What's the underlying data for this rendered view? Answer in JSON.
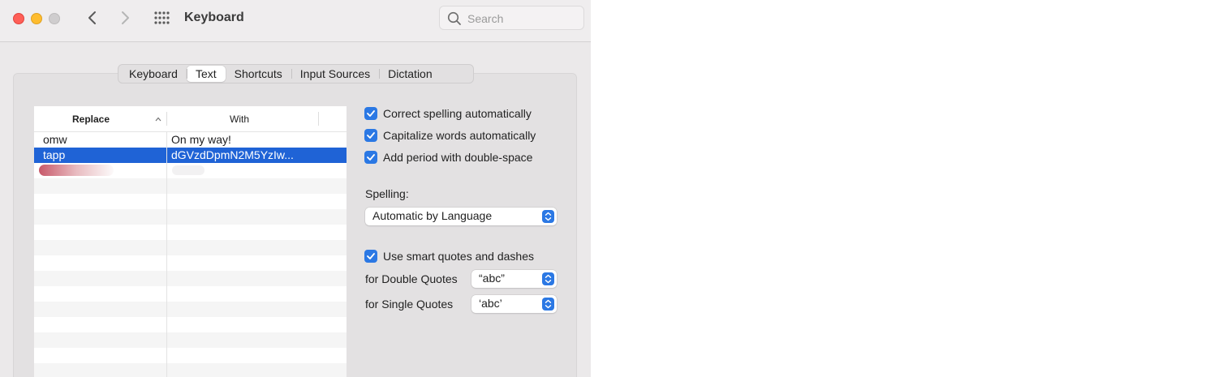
{
  "window": {
    "title": "Keyboard"
  },
  "search": {
    "placeholder": "Search"
  },
  "tabs": [
    {
      "label": "Keyboard",
      "active": false
    },
    {
      "label": "Text",
      "active": true
    },
    {
      "label": "Shortcuts",
      "active": false
    },
    {
      "label": "Input Sources",
      "active": false
    },
    {
      "label": "Dictation",
      "active": false
    }
  ],
  "table": {
    "columns": {
      "replace": "Replace",
      "with": "With"
    },
    "rows": [
      {
        "replace": "omw",
        "with": "On my way!",
        "selected": false
      },
      {
        "replace": "tapp",
        "with": "dGVzdDpmN2M5YzIw...",
        "selected": true
      },
      {
        "replace": "",
        "with": "",
        "redacted": true
      }
    ]
  },
  "options": {
    "correct_spelling": {
      "label": "Correct spelling automatically",
      "checked": true
    },
    "capitalize": {
      "label": "Capitalize words automatically",
      "checked": true
    },
    "period": {
      "label": "Add period with double-space",
      "checked": true
    },
    "spelling_label": "Spelling:",
    "spelling_value": "Automatic by Language",
    "smart_quotes": {
      "label": "Use smart quotes and dashes",
      "checked": true
    },
    "double_label": "for Double Quotes",
    "double_value": "“abc”",
    "single_label": "for Single Quotes",
    "single_value": "‘abc’"
  },
  "colors": {
    "accent": "#2b78e4",
    "selection": "#1f63d6",
    "close": "#ff5f57",
    "minimize": "#febc2e"
  },
  "icons": [
    "back-chevron-icon",
    "forward-chevron-icon",
    "grid-icon",
    "search-icon",
    "sort-ascending-icon",
    "checkmark-icon",
    "popup-arrows-icon"
  ]
}
